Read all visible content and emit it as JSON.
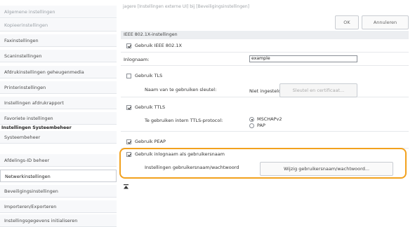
{
  "breadcrumb": "jagere [Instellingen externe UI] bij [Beveiligingsinstellingen]",
  "header": {
    "ok_label": "OK",
    "cancel_label": "Annuleren"
  },
  "sidebar": {
    "items_top": [
      "Algemene instellingen",
      "Kopieerinstellingen",
      "Faxinstellingen",
      "Scaninstellingen",
      "Afdrukinstellingen geheugenmedia",
      "Printerinstellingen",
      "Instellingen afdrukrapport",
      "Favoriete instellingen"
    ],
    "section_header": "Instellingen Systeembeheer",
    "items_bottom": [
      "Systeembeheer",
      "Afdelings-ID beheer",
      "Netwerkinstellingen",
      "Beveiligingsinstellingen",
      "Importeren/Exporteren",
      "Instellingsgegevens initialiseren"
    ]
  },
  "main": {
    "section_title": "IEEE 802.1X-instellingen",
    "use_ieee_label": "Gebruik IEEE 802.1X",
    "login_name_label": "Inlognaam:",
    "login_name_value": "example",
    "use_tls_label": "Gebruik TLS",
    "key_name_label": "Naam van te gebruiken sleutel:",
    "key_status": "Niet ingesteld.",
    "key_button": "Sleutel en certificaat...",
    "use_ttls_label": "Gebruik TTLS",
    "ttls_protocol_label": "Te gebruiken intern TTLS-protocol:",
    "radio_mschap": "MSCHAPv2",
    "radio_pap": "PAP",
    "use_peap_label": "Gebruik PEAP",
    "use_login_as_user_label": "Gebruik inlognaam als gebruikersnaam",
    "user_pw_label": "Instellingen gebruikersnaam/wachtwoord",
    "user_pw_button": "Wijzig gebruikersnaam/wachtwoord..."
  },
  "colors": {
    "highlight": "#f2a11d"
  }
}
